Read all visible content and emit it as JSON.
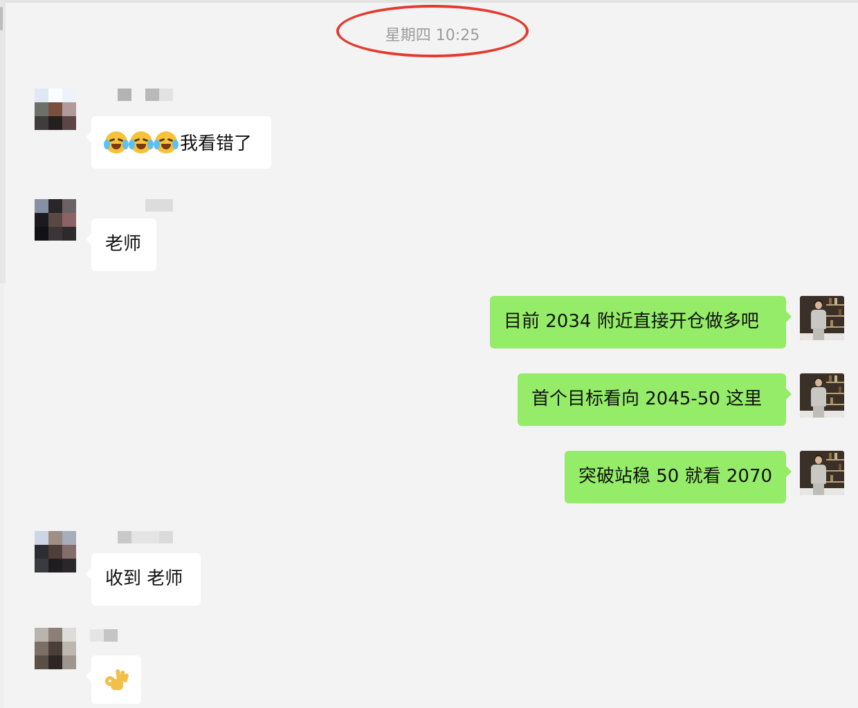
{
  "chat": {
    "timestamp": "星期四 10:25",
    "messages": [
      {
        "direction": "in",
        "text": "我看错了",
        "emojis": [
          "loudly-crying-laughing-emoji",
          "loudly-crying-laughing-emoji",
          "loudly-crying-laughing-emoji"
        ]
      },
      {
        "direction": "in",
        "text": "老师"
      },
      {
        "direction": "out",
        "text": "目前 2034 附近直接开仓做多吧"
      },
      {
        "direction": "out",
        "text": "首个目标看向 2045-50 这里"
      },
      {
        "direction": "out",
        "text": "突破站稳 50 就看 2070"
      },
      {
        "direction": "in",
        "text": "收到 老师"
      },
      {
        "direction": "in",
        "text": "",
        "emojis": [
          "ok-hand-emoji"
        ]
      }
    ]
  },
  "colors": {
    "background": "#f3f3f3",
    "incoming_bubble": "#ffffff",
    "outgoing_bubble": "#95ec69",
    "timestamp_text": "#9b9b9b",
    "highlight_circle": "#e23b2e"
  }
}
